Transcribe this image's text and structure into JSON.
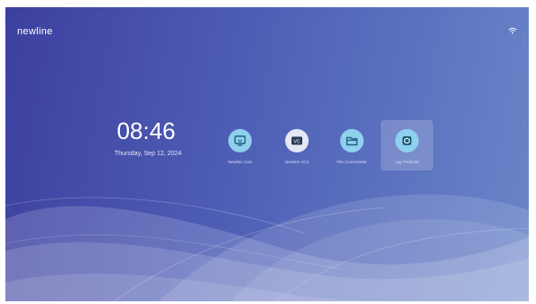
{
  "brand": "newline",
  "clock": {
    "time": "08:46",
    "date": "Thursday, Sep 12, 2024"
  },
  "apps": [
    {
      "label": "Newline Cast",
      "icon": "newline-cast-icon",
      "selected": false
    },
    {
      "label": "Newline VC3",
      "icon": "newline-vc3-icon",
      "selected": false
    },
    {
      "label": "File Commander",
      "icon": "file-commander-icon",
      "selected": false
    },
    {
      "label": "App Pedestal",
      "icon": "app-pedestal-icon",
      "selected": true
    }
  ],
  "colors": {
    "background_left": "#3d3f9f",
    "background_right": "#6a85c8",
    "app_icon_bg": "#8fd0ee",
    "app_icon_inner": "#1f5e7d"
  }
}
